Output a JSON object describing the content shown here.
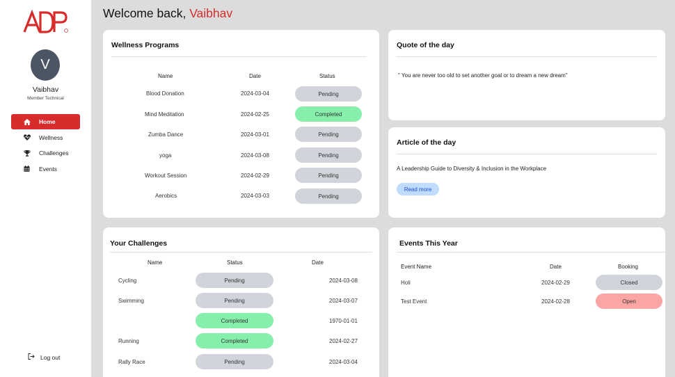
{
  "sidebar": {
    "logo_text": "ADP",
    "avatar_initial": "V",
    "user_name": "Vaibhav",
    "user_role": "Member Technical",
    "nav": [
      {
        "label": "Home",
        "icon": "home-icon",
        "active": true
      },
      {
        "label": "Wellness",
        "icon": "heartbeat-icon",
        "active": false
      },
      {
        "label": "Challenges",
        "icon": "trophy-icon",
        "active": false
      },
      {
        "label": "Events",
        "icon": "calendar-icon",
        "active": false
      }
    ],
    "logout_label": "Log out"
  },
  "header": {
    "welcome_prefix": "Welcome back,",
    "welcome_name": "Vaibhav"
  },
  "wellness": {
    "title": "Wellness Programs",
    "columns": [
      "Name",
      "Date",
      "Status"
    ],
    "rows": [
      {
        "name": "Blood Donation",
        "date": "2024-03-04",
        "status": "Pending"
      },
      {
        "name": "Mind Meditation",
        "date": "2024-02-25",
        "status": "Completed"
      },
      {
        "name": "Zumba Dance",
        "date": "2024-03-01",
        "status": "Pending"
      },
      {
        "name": "yoga",
        "date": "2024-03-08",
        "status": "Pending"
      },
      {
        "name": "Workout Session",
        "date": "2024-02-29",
        "status": "Pending"
      },
      {
        "name": "Aerobics",
        "date": "2024-03-03",
        "status": "Pending"
      }
    ]
  },
  "quote": {
    "title": "Quote of the day",
    "text": "\" You are never too old to set another goal or to dream a new dream\""
  },
  "article": {
    "title": "Article of the day",
    "text": "A Leadership Guide to Diversity & Inclusion in the Workplace",
    "button_label": "Read more"
  },
  "challenges": {
    "title": "Your Challenges",
    "columns": [
      "Name",
      "Status",
      "Date"
    ],
    "rows": [
      {
        "name": "Cycling",
        "status": "Pending",
        "date": "2024-03-08"
      },
      {
        "name": "Swimming",
        "status": "Pending",
        "date": "2024-03-07"
      },
      {
        "name": "",
        "status": "Completed",
        "date": "1970-01-01"
      },
      {
        "name": "Running",
        "status": "Completed",
        "date": "2024-02-27"
      },
      {
        "name": "Rally Race",
        "status": "Pending",
        "date": "2024-03-04"
      }
    ]
  },
  "events": {
    "title": "Events This Year",
    "columns": [
      "Event Name",
      "Date",
      "Booking"
    ],
    "rows": [
      {
        "name": "Holi",
        "date": "2024-02-29",
        "booking": "Closed"
      },
      {
        "name": "Test Event",
        "date": "2024-02-28",
        "booking": "Open"
      }
    ]
  },
  "colors": {
    "brand_red": "#d82c2c",
    "pending": "#d1d5db",
    "completed": "#86efac",
    "open": "#fca5a5",
    "readmore_bg": "#bfdbfe"
  }
}
